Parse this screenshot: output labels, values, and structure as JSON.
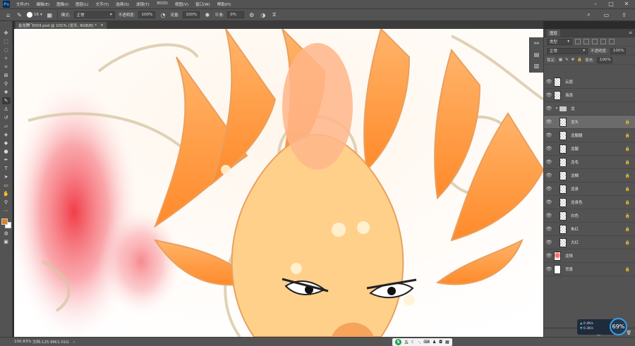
{
  "app": {
    "logo": "Ps",
    "menu": [
      "文件(F)",
      "编辑(E)",
      "图像(I)",
      "图层(L)",
      "文字(Y)",
      "选择(S)",
      "滤镜(T)",
      "3D(D)",
      "视图(V)",
      "窗口(W)",
      "帮助(H)"
    ],
    "window_controls": [
      "–",
      "□",
      "✕"
    ]
  },
  "options_bar": {
    "brush_size": "16",
    "mode_label": "模式:",
    "mode_value": "正常",
    "opacity_label": "不透明度:",
    "opacity_value": "100%",
    "flow_label": "流量:",
    "flow_value": "100%",
    "smoothing_label": "平滑:",
    "smoothing_value": "0%"
  },
  "document": {
    "tab_title": "金龙腾飞003.psd @ 101% (龙头, RGB/8) *",
    "tab_close": "×"
  },
  "status": {
    "zoom": "100.83%",
    "doc_size": "文档:125.9M/1.01G",
    "ime_label": "五"
  },
  "layers_panel": {
    "tab_label": "图层",
    "filter_label": "类型",
    "blend_mode": "正常",
    "opacity_label": "不透明度:",
    "opacity_value": "100%",
    "lock_label": "锁定:",
    "fill_label": "填充:",
    "fill_value": "100%",
    "layers": [
      {
        "name": "云层",
        "thumb": "checker",
        "indent": false,
        "folder": false,
        "lock": false,
        "selected": false
      },
      {
        "name": "海浪",
        "thumb": "checker",
        "indent": false,
        "folder": false,
        "lock": false,
        "selected": false
      },
      {
        "name": "龙",
        "thumb": "folder",
        "indent": false,
        "folder": true,
        "lock": false,
        "selected": false
      },
      {
        "name": "龙头",
        "thumb": "checker",
        "indent": true,
        "folder": false,
        "lock": true,
        "selected": true
      },
      {
        "name": "龙腿腿",
        "thumb": "checker",
        "indent": true,
        "folder": false,
        "lock": true,
        "selected": false
      },
      {
        "name": "龙腿",
        "thumb": "checker",
        "indent": true,
        "folder": false,
        "lock": true,
        "selected": false
      },
      {
        "name": "龙毛",
        "thumb": "checker",
        "indent": true,
        "folder": false,
        "lock": true,
        "selected": false
      },
      {
        "name": "龙鳞",
        "thumb": "checker",
        "indent": true,
        "folder": false,
        "lock": true,
        "selected": false
      },
      {
        "name": "龙身",
        "thumb": "checker",
        "indent": true,
        "folder": false,
        "lock": true,
        "selected": false
      },
      {
        "name": "龙身色",
        "thumb": "checker",
        "indent": true,
        "folder": false,
        "lock": true,
        "selected": false
      },
      {
        "name": "白色",
        "thumb": "checker",
        "indent": true,
        "folder": false,
        "lock": true,
        "selected": false
      },
      {
        "name": "朱红",
        "thumb": "checker",
        "indent": true,
        "folder": false,
        "lock": true,
        "selected": false
      },
      {
        "name": "大红",
        "thumb": "checker",
        "indent": true,
        "folder": false,
        "lock": true,
        "selected": false
      },
      {
        "name": "龙珠",
        "thumb": "pearl",
        "indent": false,
        "folder": false,
        "lock": false,
        "selected": false
      },
      {
        "name": "背景",
        "thumb": "white",
        "indent": false,
        "folder": false,
        "lock": true,
        "selected": false
      }
    ]
  },
  "performance": {
    "upload": "0.4K/s",
    "download": "0.3K/s",
    "percent": "69%"
  },
  "colors": {
    "foreground": "#d9822b",
    "background": "#ffffff",
    "selected_layer": "#6b6b6b"
  }
}
